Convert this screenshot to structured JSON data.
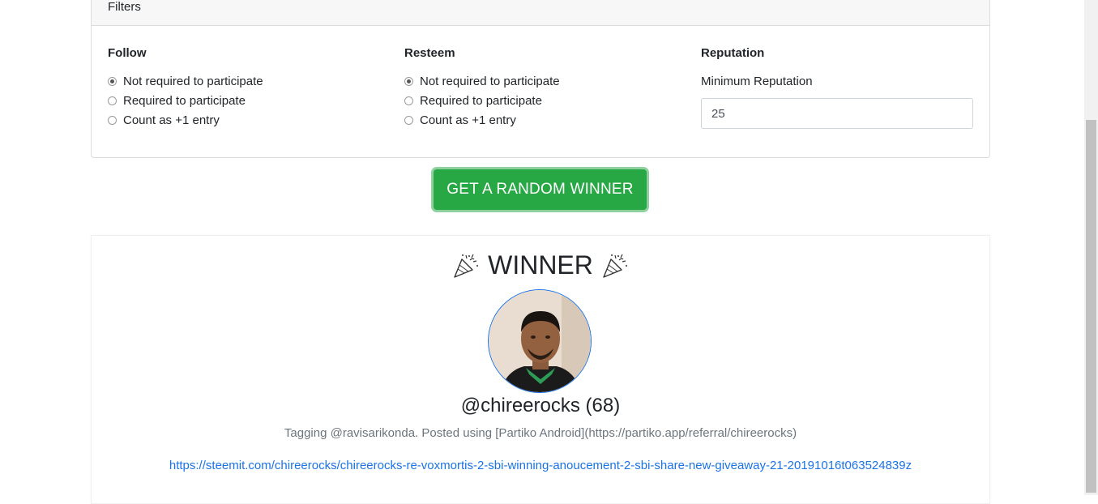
{
  "filters": {
    "title": "Filters",
    "follow": {
      "title": "Follow",
      "options": [
        "Not required to participate",
        "Required to participate",
        "Count as +1 entry"
      ],
      "selected_index": 0
    },
    "resteem": {
      "title": "Resteem",
      "options": [
        "Not required to participate",
        "Required to participate",
        "Count as +1 entry"
      ],
      "selected_index": 0
    },
    "reputation": {
      "title": "Reputation",
      "min_label": "Minimum Reputation",
      "min_value": "25"
    }
  },
  "action": {
    "button_label": "GET A RANDOM WINNER",
    "button_color": "#28a745"
  },
  "result": {
    "heading": "WINNER",
    "icons": [
      "party-popper-icon",
      "party-popper-icon"
    ],
    "username": "@chireerocks (68)",
    "tagline": "Tagging @ravisarikonda. Posted using [Partiko Android](https://partiko.app/referral/chireerocks)",
    "link": "https://steemit.com/chireerocks/chireerocks-re-voxmortis-2-sbi-winning-anoucement-2-sbi-share-new-giveaway-21-20191016t063524839z",
    "link_color": "#1a73e8"
  }
}
